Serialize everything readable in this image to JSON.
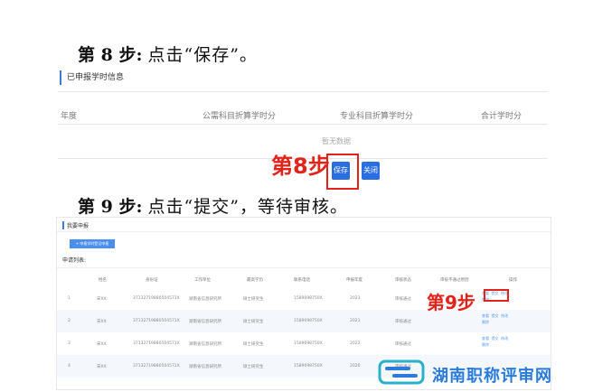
{
  "step8": {
    "label": "第 8 步:",
    "text": "点击“保存”。"
  },
  "step9": {
    "label": "第 9 步:",
    "text": "点击“提交”，等待审核。"
  },
  "shot1": {
    "section_title": "已申报学时信息",
    "headers": [
      "年度",
      "公需科目折算学时分",
      "专业科目折算学时分",
      "合计学时分"
    ],
    "empty_text": "暂无数据",
    "save_label": "保存",
    "close_label": "关闭",
    "annotation": "第8步"
  },
  "shot2": {
    "title": "我要申报",
    "add_button": "+ 申报学时登记申报",
    "list_title": "申请列表:",
    "columns": [
      "姓名",
      "身份证",
      "工作单位",
      "最高学历",
      "联系电话",
      "申报年度",
      "审核状态",
      "审核不通过原因",
      "操作"
    ],
    "rows": [
      {
        "idx": "1",
        "name": "宋XX",
        "id": "37132719880504571X",
        "unit": "湖南省信息研究所",
        "edu": "硕士研究生",
        "phone": "1589098750X",
        "year": "2023",
        "status": "审核通过"
      },
      {
        "idx": "2",
        "name": "宋XX",
        "id": "37132719880504571X",
        "unit": "湖南省信息研究所",
        "edu": "硕士研究生",
        "phone": "1589098750X",
        "year": "2021",
        "status": "审核通过"
      },
      {
        "idx": "3",
        "name": "宋XX",
        "id": "37132719880504571X",
        "unit": "湖南省信息研究所",
        "edu": "硕士研究生",
        "phone": "1589098750X",
        "year": "2022",
        "status": "审核通过"
      },
      {
        "idx": "4",
        "name": "宋XX",
        "id": "37132719880504571X",
        "unit": "湖南省信息研究所",
        "edu": "硕士研究生",
        "phone": "1589098750X",
        "year": "2020",
        "status": "审核通过"
      }
    ],
    "ops": [
      "查看",
      "提交",
      "修改",
      "删除"
    ],
    "annotation": "第9步"
  },
  "watermark": {
    "text": "湖南职称评审网"
  }
}
